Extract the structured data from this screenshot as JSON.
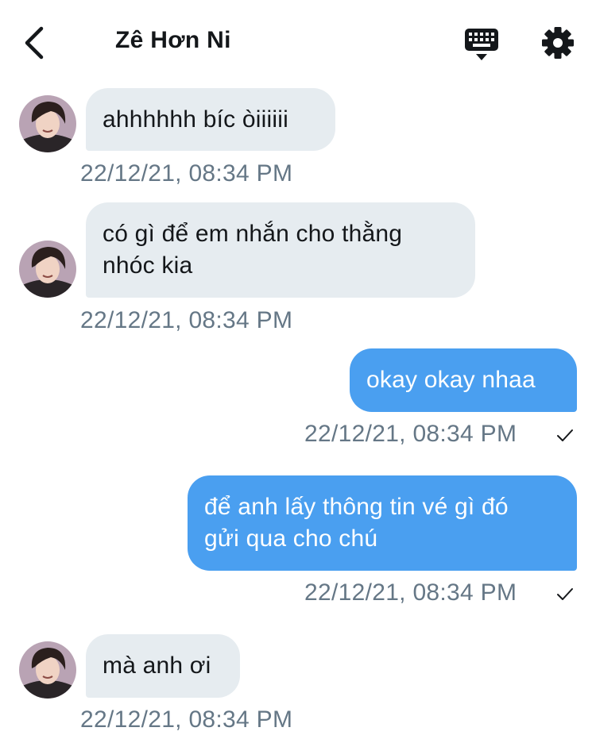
{
  "header": {
    "title": "Zê Hơn Ni",
    "back_icon": "chevron-left-icon",
    "keyboard_icon": "keyboard-icon",
    "settings_icon": "gear-icon"
  },
  "colors": {
    "incoming_bubble": "#e6ecf0",
    "outgoing_bubble": "#4a9ff0",
    "timestamp": "#657786",
    "text": "#14171a"
  },
  "messages": [
    {
      "direction": "incoming",
      "text": "ahhhhhh bíc òiiiiii",
      "time": "22/12/21, 08:34 PM"
    },
    {
      "direction": "incoming",
      "text": "có gì để em nhắn cho thằng\nnhóc kia",
      "time": "22/12/21, 08:34 PM"
    },
    {
      "direction": "outgoing",
      "text": "okay okay nhaa",
      "time": "22/12/21, 08:34 PM",
      "status_icon": "checkmark-icon"
    },
    {
      "direction": "outgoing",
      "text": "để anh lấy thông tin vé gì đó\ngửi qua cho chú",
      "time": "22/12/21, 08:34 PM",
      "status_icon": "checkmark-icon"
    },
    {
      "direction": "incoming",
      "text": "mà anh ơi",
      "time": "22/12/21, 08:34 PM"
    }
  ]
}
